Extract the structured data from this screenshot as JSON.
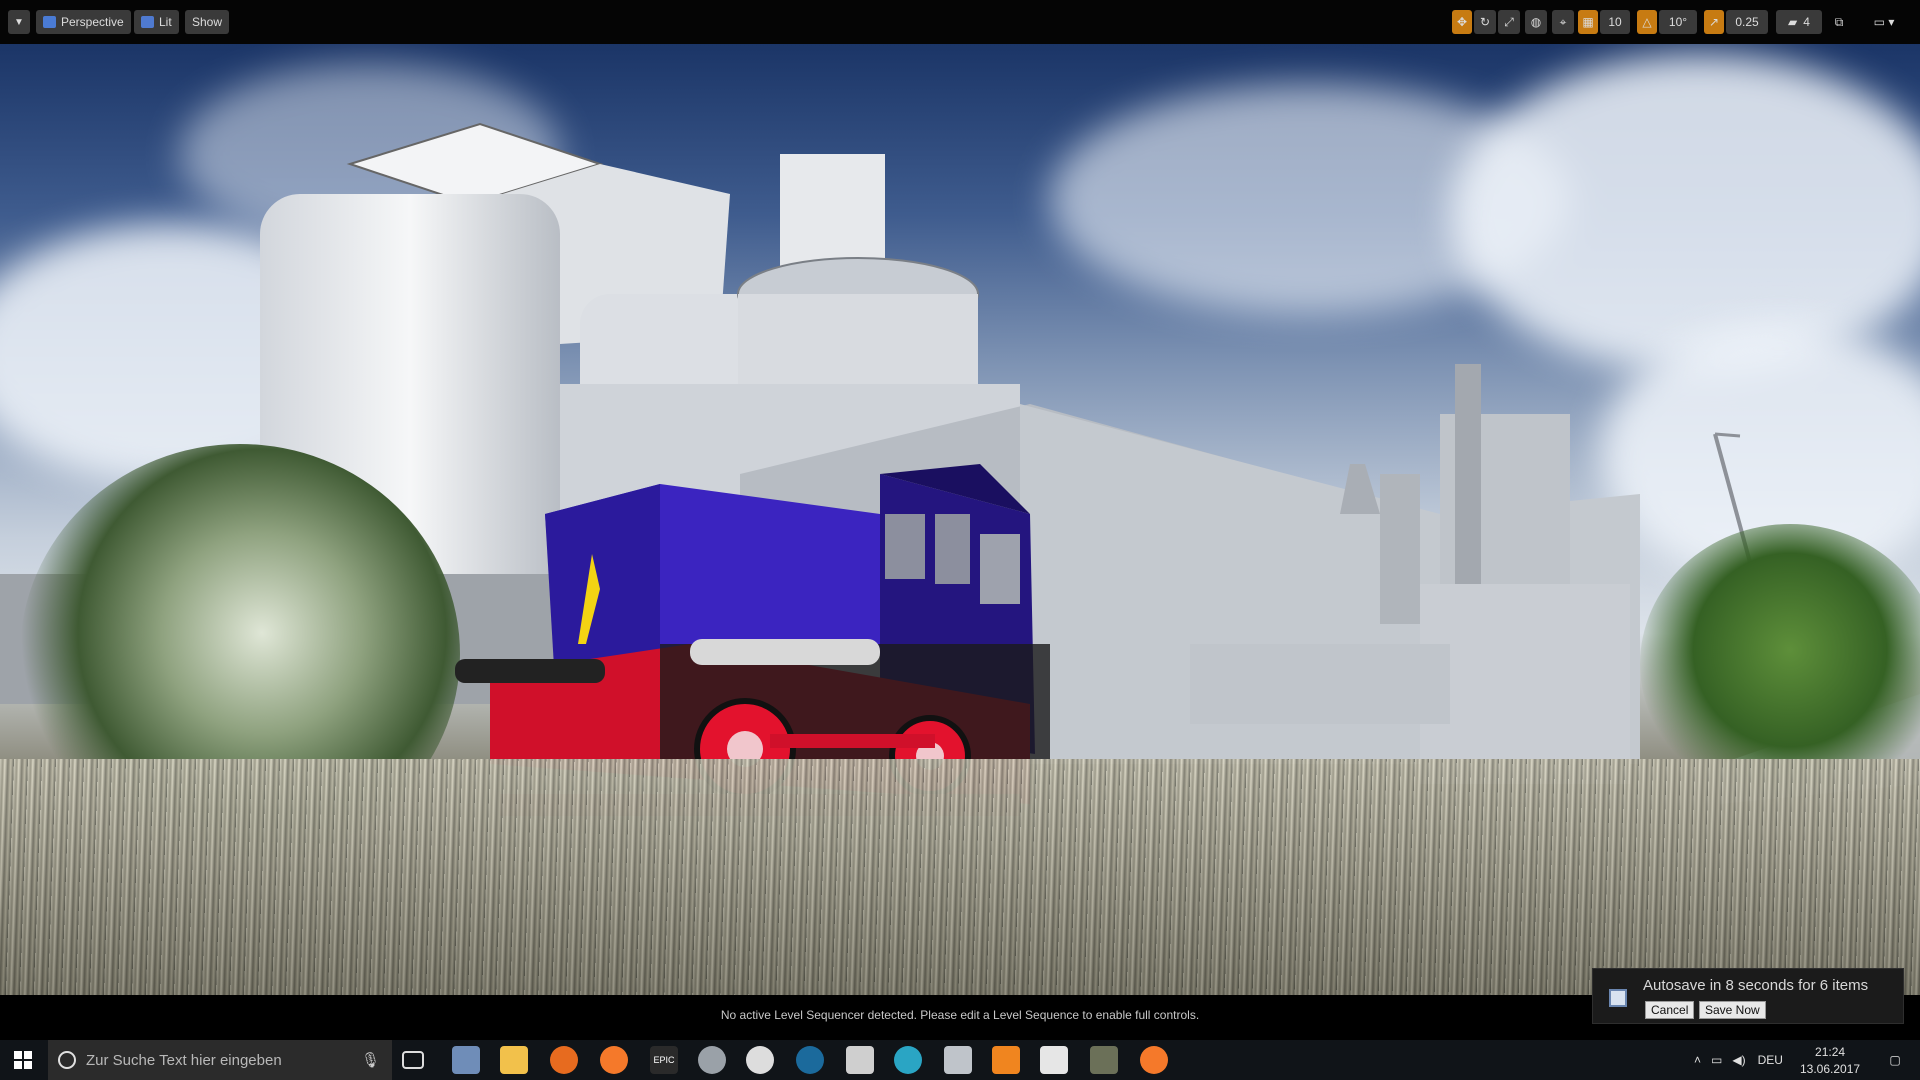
{
  "toolbar": {
    "view_mode_label": "Perspective",
    "lighting_label": "Lit",
    "show_label": "Show",
    "grid_snap_value": "10",
    "rotation_snap_value": "10°",
    "scale_snap_value": "0.25",
    "camera_speed_value": "4"
  },
  "viewport": {
    "sequencer_message": "No active Level Sequencer detected. Please edit a Level Sequence to enable full controls."
  },
  "autosave": {
    "message": "Autosave in 8 seconds for 6 items",
    "cancel_label": "Cancel",
    "save_now_label": "Save Now"
  },
  "taskbar": {
    "search_placeholder": "Zur Suche Text hier eingeben",
    "language": "DEU",
    "time": "21:24",
    "date": "13.06.2017",
    "epic_label": "EPIC"
  },
  "colors": {
    "accent_orange": "#c77b12",
    "locomotive_body": "#3a1fb5",
    "locomotive_frame": "#d0102a"
  }
}
